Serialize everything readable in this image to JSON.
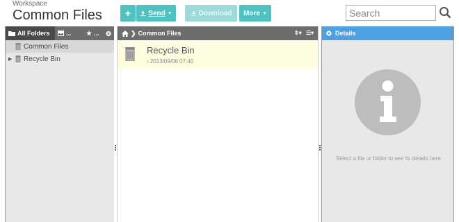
{
  "header": {
    "workspace_label": "Workspace",
    "title": "Common Files"
  },
  "toolbar": {
    "add_icon": "plus-icon",
    "send_label": "Send",
    "download_label": "Download",
    "more_label": "More"
  },
  "search": {
    "placeholder": "Search"
  },
  "left_panel": {
    "tabs": [
      {
        "label": "All Folders",
        "icon": "folder-icon"
      },
      {
        "label": "...",
        "icon": "inbox-icon"
      },
      {
        "label": "...",
        "icon": "star-icon"
      },
      {
        "label": "",
        "icon": "close-circle-icon"
      }
    ],
    "tree": [
      {
        "label": "Common Files",
        "icon": "trash-icon"
      },
      {
        "label": "Recycle Bin",
        "icon": "trash-icon"
      }
    ]
  },
  "middle_panel": {
    "breadcrumb": "Common Files",
    "files": [
      {
        "name": "Recycle Bin",
        "date": "2013/09/06 07:40"
      }
    ]
  },
  "details_panel": {
    "title": "Details",
    "empty_text": "Select a file or folder to see its details here"
  },
  "colors": {
    "accent": "#4fc1c0",
    "details_header": "#4fa0e0",
    "tab_bar": "#6d6d6d",
    "selected_row": "#fefde0"
  }
}
